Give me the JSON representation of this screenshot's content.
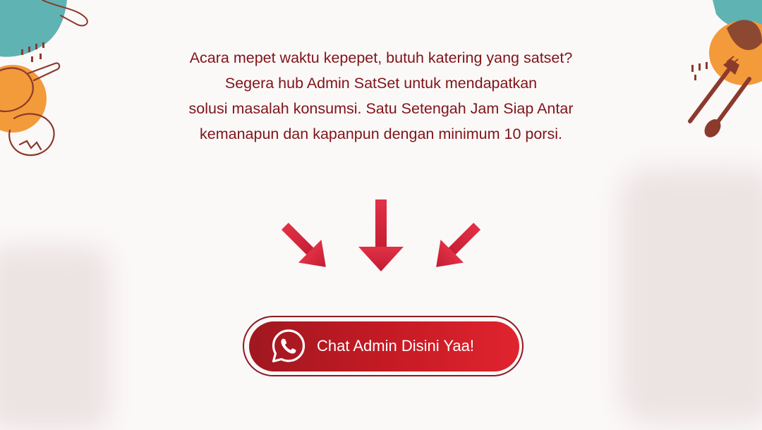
{
  "intro": {
    "lines": [
      "Acara mepet waktu kepepet, butuh katering yang satset?",
      "Segera hub Admin SatSet untuk mendapatkan",
      "solusi masalah konsumsi. Satu Setengah Jam Siap Antar",
      "kemanapun dan kapanpun dengan minimum 10 porsi."
    ]
  },
  "cta": {
    "label": "Chat Admin Disini Yaa!",
    "icon": "whatsapp-icon"
  },
  "colors": {
    "text": "#7f1418",
    "arrow": "#d6273e",
    "button_start": "#a01820",
    "button_end": "#e0242e",
    "teal": "#5fb3b3",
    "orange": "#f39a3a",
    "utensil": "#8b3a2c"
  },
  "icons": [
    "arrow-down-right-icon",
    "arrow-down-icon",
    "arrow-down-left-icon",
    "fork-icon",
    "spoon-icon",
    "tomato-icon",
    "pan-icon"
  ]
}
